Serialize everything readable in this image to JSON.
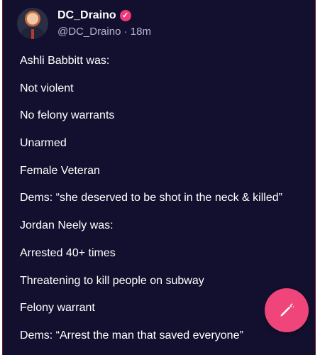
{
  "post": {
    "author": {
      "display_name": "DC_Draino",
      "handle": "@DC_Draino",
      "separator": "·",
      "time": "18m",
      "verified_icon": "verified-badge-icon",
      "avatar_icon": "avatar"
    },
    "lines": [
      "Ashli Babbitt was:",
      "Not violent",
      "No felony warrants",
      "Unarmed",
      "Female Veteran",
      "Dems: “she deserved to be shot in the neck & killed”",
      "Jordan Neely was:",
      "Arrested 40+ times",
      "Threatening to kill people on subway",
      "Felony warrant",
      "Dems: “Arrest the man that saved everyone”"
    ]
  },
  "fab": {
    "icon": "compose-icon",
    "color": "#f0457a"
  },
  "colors": {
    "background": "#12102e",
    "text": "#ffffff",
    "muted": "#b7b5cf",
    "accent": "#f0397a"
  }
}
